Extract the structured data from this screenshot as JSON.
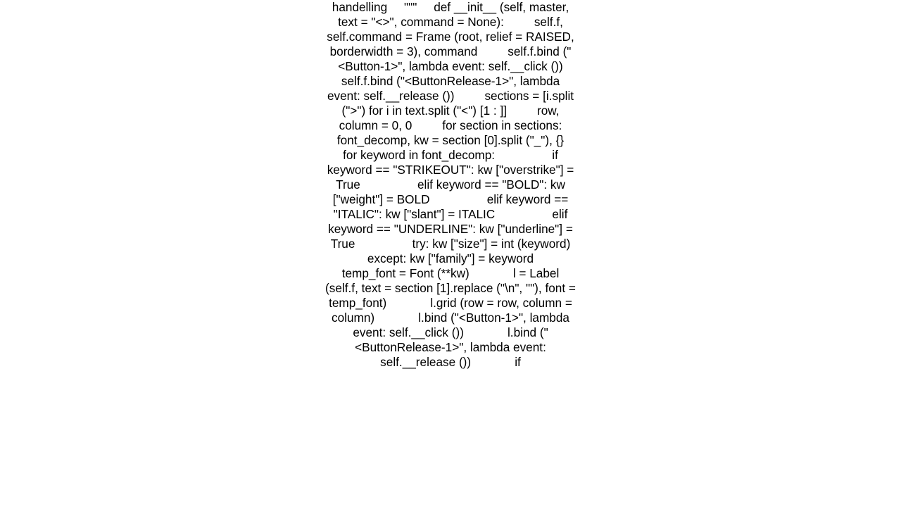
{
  "code_block": {
    "text": "handelling     \"\"\"     def __init__ (self, master, text = \"<>\", command = None):         self.f, self.command = Frame (root, relief = RAISED, borderwidth = 3), command         self.f.bind (\"<Button-1>\", lambda event: self.__click ())         self.f.bind (\"<ButtonRelease-1>\", lambda event: self.__release ())         sections = [i.split (\">\") for i in text.split (\"<\") [1 : ]]         row, column = 0, 0         for section in sections:             font_decomp, kw = section [0].split (\"_\"), {}             for keyword in font_decomp:                 if keyword == \"STRIKEOUT\": kw [\"overstrike\"] = True                 elif keyword == \"BOLD\": kw [\"weight\"] = BOLD                 elif keyword == \"ITALIC\": kw [\"slant\"] = ITALIC                 elif keyword == \"UNDERLINE\": kw [\"underline\"] = True                 try: kw [\"size\"] = int (keyword)                 except: kw [\"family\"] = keyword             temp_font = Font (**kw)             l = Label (self.f, text = section [1].replace (\"\\n\", \"\"), font = temp_font)             l.grid (row = row, column = column)             l.bind (\"<Button-1>\", lambda event: self.__click ())             l.bind (\"<ButtonRelease-1>\", lambda event: self.__release ())             if"
  }
}
